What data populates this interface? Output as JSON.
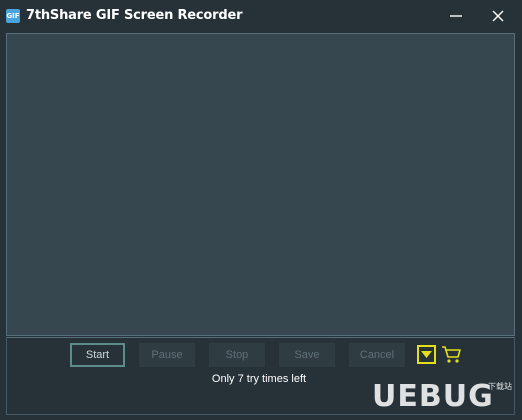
{
  "window": {
    "title": "7thShare GIF Screen Recorder",
    "icon_text": "GIF"
  },
  "controls": {
    "start": "Start",
    "pause": "Pause",
    "stop": "Stop",
    "save": "Save",
    "cancel": "Cancel"
  },
  "trial": {
    "message": "Only 7 try times left"
  },
  "watermark": {
    "text": "UEBUG",
    "sub": "下载站"
  },
  "colors": {
    "accent_yellow": "#e3e01a",
    "start_border": "#5d8d8a",
    "canvas": "#37474f",
    "background": "#263238"
  }
}
